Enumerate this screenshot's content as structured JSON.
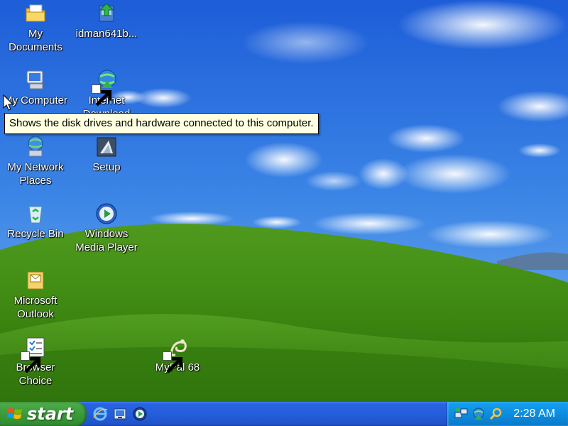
{
  "desktop": {
    "icons": [
      {
        "label": "My\nDocuments",
        "icon": "my-documents-icon"
      },
      {
        "label": "idman641b...",
        "icon": "installer-icon",
        "shortcut": false
      },
      {
        "label": "My Computer",
        "icon": "my-computer-icon"
      },
      {
        "label": "Internet\nDownload",
        "icon": "internet-download-manager-icon",
        "shortcut": true
      },
      {
        "label": "My Network\nPlaces",
        "icon": "network-places-icon"
      },
      {
        "label": "Setup",
        "icon": "setup-icon"
      },
      {
        "label": "Recycle Bin",
        "icon": "recycle-bin-icon"
      },
      {
        "label": "Windows\nMedia Player",
        "icon": "media-player-icon"
      },
      {
        "label": "Microsoft\nOutlook",
        "icon": "outlook-icon"
      },
      {
        "label": "Browser\nChoice",
        "icon": "browser-choice-icon",
        "shortcut": true
      },
      {
        "label": "MyPal 68",
        "icon": "mypal-icon",
        "shortcut": true
      }
    ]
  },
  "tooltip": {
    "text": "Shows the disk drives and hardware connected to this computer."
  },
  "taskbar": {
    "start_label": "start",
    "quick_launch": [
      "internet-explorer-icon",
      "show-desktop-icon",
      "media-player-icon"
    ],
    "tray_icons": [
      "network-icon",
      "download-manager-icon",
      "search-icon"
    ],
    "clock": "2:28 AM"
  },
  "colors": {
    "taskbar_blue": "#245edb",
    "start_green": "#3c9d3c",
    "tray_blue": "#0d8de0",
    "tooltip_bg": "#ffffe1"
  }
}
